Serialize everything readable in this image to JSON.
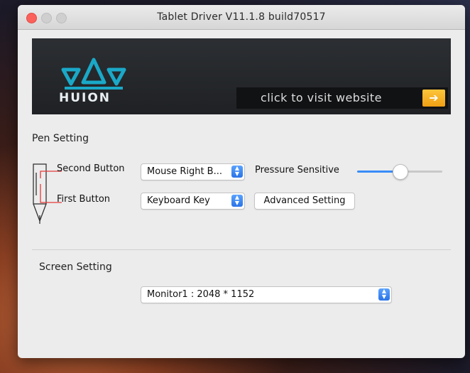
{
  "window": {
    "title": "Tablet Driver V11.1.8 build70517"
  },
  "banner": {
    "brand": "HUION",
    "visit_label": "click to visit website"
  },
  "pen_setting": {
    "title": "Pen Setting",
    "second_button_label": "Second Button",
    "second_button_value": "Mouse Right B...",
    "first_button_label": "First Button",
    "first_button_value": "Keyboard Key",
    "pressure_label": "Pressure Sensitive",
    "pressure_level": 0.5,
    "advanced_label": "Advanced Setting"
  },
  "screen_setting": {
    "title": "Screen Setting",
    "monitor_value": "Monitor1 : 2048 * 1152"
  },
  "colors": {
    "accent": "#3a8cf7",
    "close": "#fc605b",
    "banner_bg": "#26282b",
    "visit_arrow": "#f5b324"
  },
  "icons": {
    "logo": "huion-crown-logo",
    "visit": "arrow-right-icon",
    "stepper": "stepper-icon",
    "pen": "pen-icon"
  }
}
